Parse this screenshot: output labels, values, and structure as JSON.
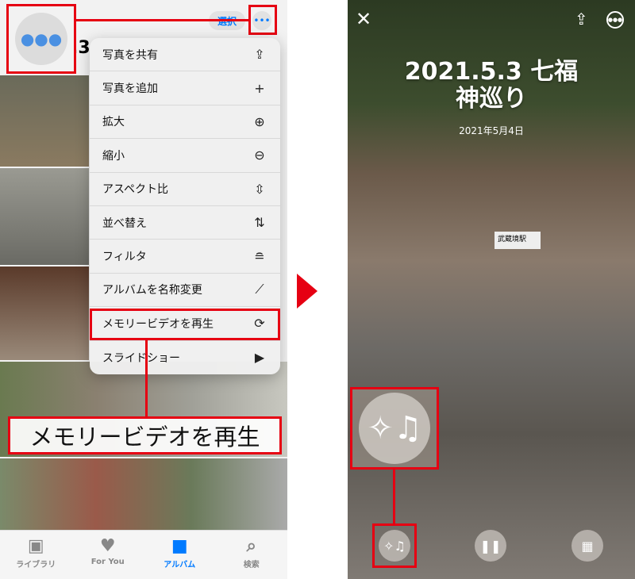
{
  "left": {
    "header": {
      "select_label": "選択",
      "title_fragment": ".3"
    },
    "menu": [
      {
        "label": "写真を共有",
        "icon": "share-icon",
        "glyph": "⇪"
      },
      {
        "label": "写真を追加",
        "icon": "plus-icon",
        "glyph": "+"
      },
      {
        "label": "拡大",
        "icon": "zoom-in-icon",
        "glyph": "⊕"
      },
      {
        "label": "縮小",
        "icon": "zoom-out-icon",
        "glyph": "⊖"
      },
      {
        "label": "アスペクト比",
        "icon": "aspect-ratio-icon",
        "glyph": "⇳"
      },
      {
        "label": "並べ替え",
        "icon": "sort-icon",
        "glyph": "⇅"
      },
      {
        "label": "フィルタ",
        "icon": "filter-icon",
        "glyph": "≘"
      },
      {
        "label": "アルバムを名称変更",
        "icon": "pencil-icon",
        "glyph": "⟋"
      },
      {
        "label": "メモリービデオを再生",
        "icon": "memory-play-icon",
        "glyph": "⟳"
      },
      {
        "label": "スライドショー",
        "icon": "slideshow-icon",
        "glyph": "▶"
      }
    ],
    "callout": "メモリービデオを再生",
    "tabs": [
      {
        "label": "ライブラリ",
        "icon": "library-icon",
        "glyph": "▣"
      },
      {
        "label": "For You",
        "icon": "for-you-icon",
        "glyph": "♥"
      },
      {
        "label": "アルバム",
        "icon": "album-icon",
        "glyph": "■",
        "active": true
      },
      {
        "label": "検索",
        "icon": "search-icon",
        "glyph": "⌕"
      }
    ]
  },
  "right": {
    "title_line1": "2021.5.3 七福",
    "title_line2": "神巡り",
    "date": "2021年5月4日",
    "station_sign": "武蔵境駅"
  },
  "colors": {
    "accent": "#007aff",
    "highlight": "#e60012"
  }
}
